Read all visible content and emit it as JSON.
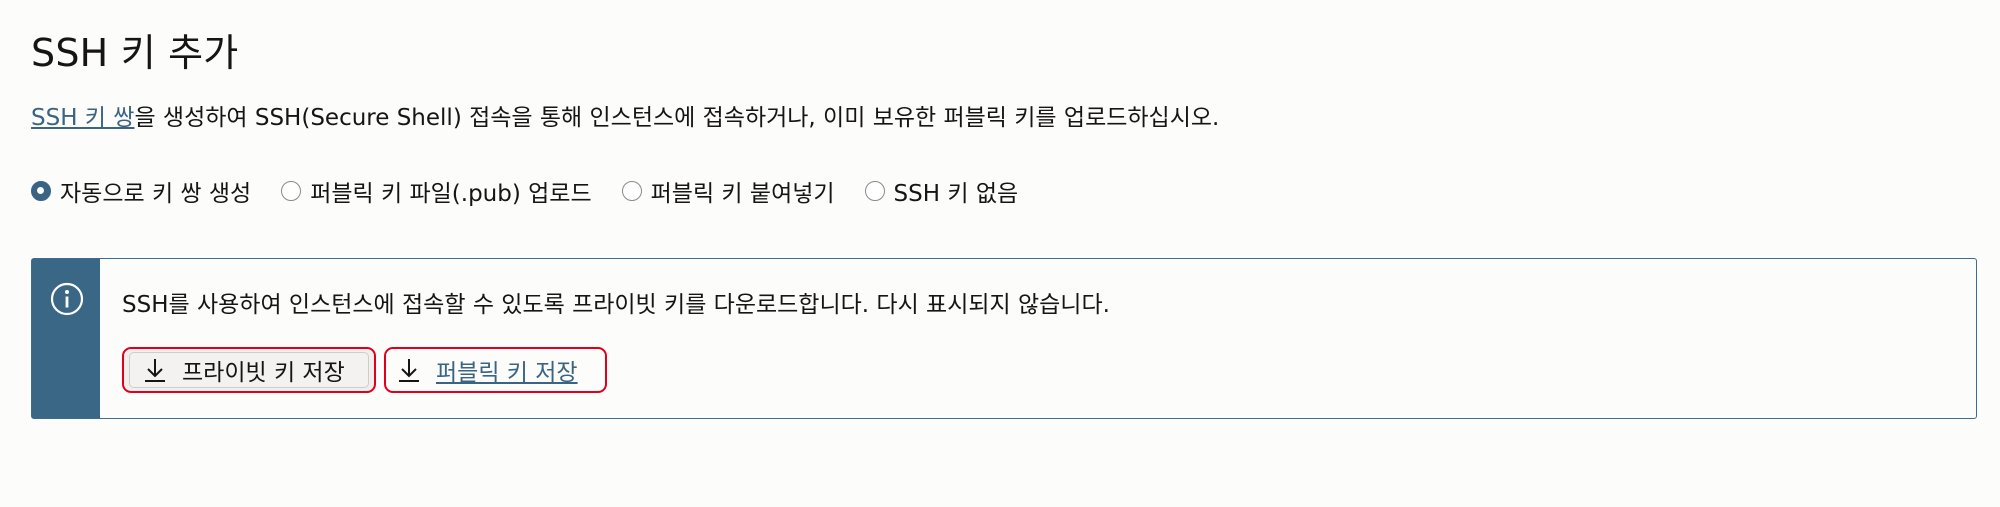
{
  "header": {
    "title": "SSH 키 추가"
  },
  "description": {
    "link_text": "SSH 키 쌍",
    "rest_text": "을 생성하여 SSH(Secure Shell) 접속을 통해 인스턴스에 접속하거나, 이미 보유한 퍼블릭 키를 업로드하십시오."
  },
  "options": {
    "selected": "자동으로 키 쌍 생성",
    "items": [
      {
        "label": "자동으로 키 쌍 생성",
        "checked": true
      },
      {
        "label": "퍼블릭 키 파일(.pub) 업로드",
        "checked": false
      },
      {
        "label": "퍼블릭 키 붙여넣기",
        "checked": false
      },
      {
        "label": "SSH 키 없음",
        "checked": false
      }
    ]
  },
  "notice": {
    "icon": "info-icon",
    "message": "SSH를 사용하여 인스턴스에 접속할 수 있도록 프라이빗 키를 다운로드합니다. 다시 표시되지 않습니다.",
    "buttons": {
      "save_private_label": "프라이빗 키 저장",
      "save_public_label": "퍼블릭 키 저장"
    }
  },
  "colors": {
    "accent": "#3a6483",
    "notice_bar": "#3b6787",
    "highlight_border": "#e0001b",
    "background": "#fcfcfb"
  }
}
